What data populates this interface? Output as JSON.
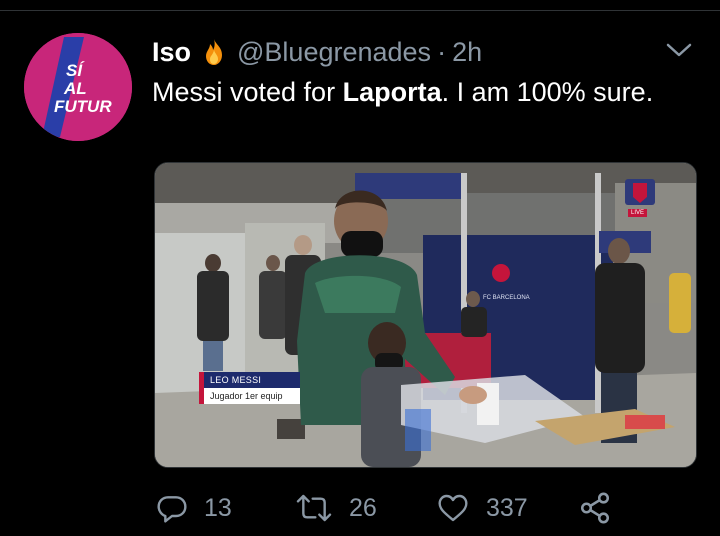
{
  "tweet": {
    "display_name": "Iso",
    "handle": "@Bluegrenades",
    "separator": "·",
    "time": "2h",
    "text_parts": {
      "before": "Messi voted for ",
      "bold": "Laporta",
      "after": ".  I am 100% sure."
    }
  },
  "avatar": {
    "lines": [
      "SÍ",
      "AL",
      "FUTUR"
    ]
  },
  "media": {
    "lower_third_name": "LEO MESSI",
    "lower_third_role": "Jugador 1er equip",
    "live_label": "LIVE",
    "backdrop_text": "FC BARCELONA"
  },
  "actions": {
    "reply_count": "13",
    "retweet_count": "26",
    "like_count": "337"
  },
  "colors": {
    "background": "#000000",
    "text": "#ffffff",
    "muted": "#8b98a5",
    "avatar_pink": "#c8267a",
    "avatar_blue": "#2a3ea8",
    "barca_red": "#c4153b",
    "barca_blue": "#1d2a6c"
  },
  "icons": {
    "fire": "fire-icon",
    "chevron": "chevron-down-icon",
    "reply": "reply-icon",
    "retweet": "retweet-icon",
    "like": "like-icon",
    "share": "share-icon"
  }
}
